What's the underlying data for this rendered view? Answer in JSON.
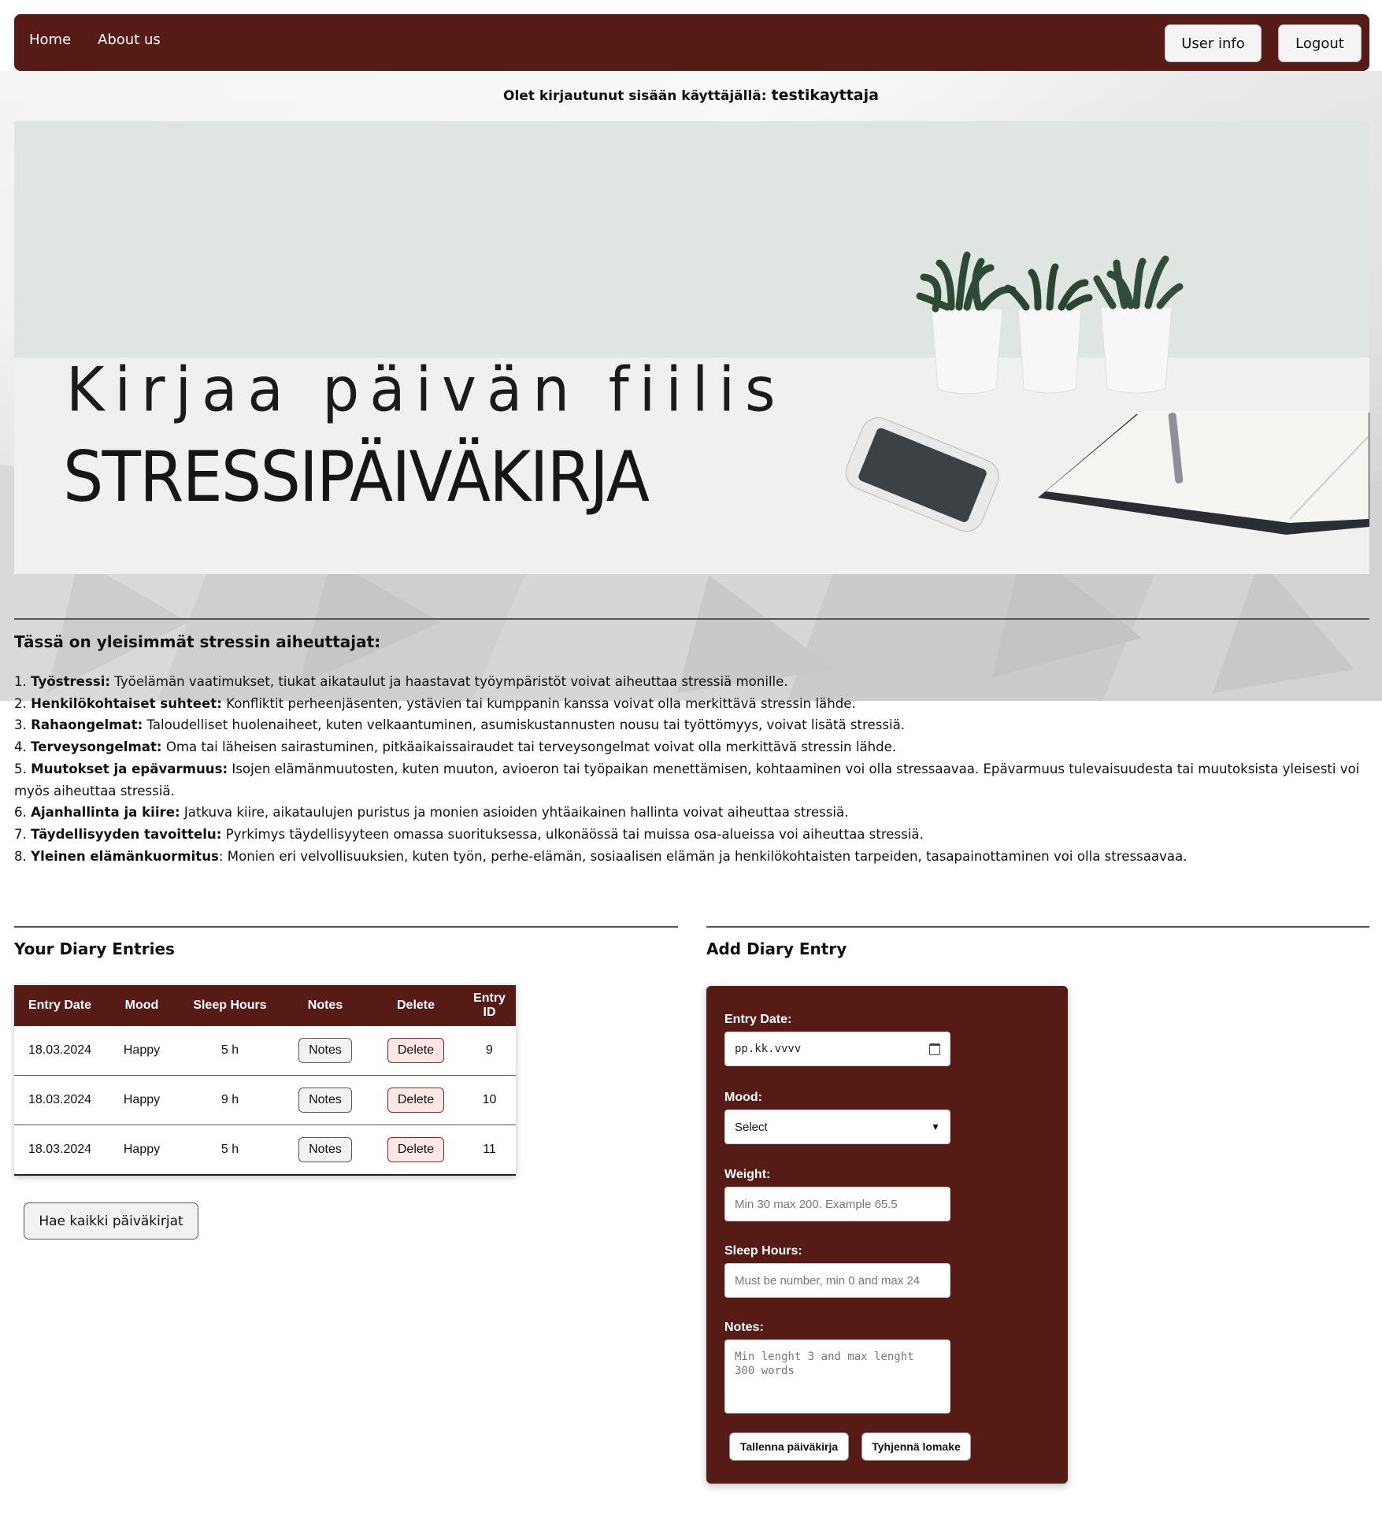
{
  "nav": {
    "home": "Home",
    "about": "About us",
    "user_info": "User info",
    "logout": "Logout"
  },
  "login": {
    "prefix": "Olet kirjautunut sisään käyttäjällä:",
    "username": "testikayttaja"
  },
  "hero": {
    "line1": "Kirjaa päivän fiilis",
    "line2": "STRESSIPÄIVÄKIRJA"
  },
  "causes": {
    "heading": "Tässä on yleisimmät stressin aiheuttajat:",
    "items": [
      {
        "num": "1.",
        "title": "Työstressi:",
        "text": " Työelämän vaatimukset, tiukat aikataulut ja haastavat työympäristöt voivat aiheuttaa stressiä monille."
      },
      {
        "num": "2.",
        "title": "Henkilökohtaiset suhteet:",
        "text": " Konfliktit perheenjäsenten, ystävien tai kumppanin kanssa voivat olla merkittävä stressin lähde."
      },
      {
        "num": "3.",
        "title": "Rahaongelmat:",
        "text": " Taloudelliset huolenaiheet, kuten velkaantuminen, asumiskustannusten nousu tai työttömyys, voivat lisätä stressiä."
      },
      {
        "num": "4.",
        "title": "Terveysongelmat:",
        "text": " Oma tai läheisen sairastuminen, pitkäaikaissairaudet tai terveysongelmat voivat olla merkittävä stressin lähde."
      },
      {
        "num": "5.",
        "title": "Muutokset ja epävarmuus:",
        "text": " Isojen elämänmuutosten, kuten muuton, avioeron tai työpaikan menettämisen, kohtaaminen voi olla stressaavaa. Epävarmuus tulevaisuudesta tai muutoksista yleisesti voi myös aiheuttaa stressiä."
      },
      {
        "num": "6.",
        "title": "Ajanhallinta ja kiire:",
        "text": " Jatkuva kiire, aikataulujen puristus ja monien asioiden yhtäaikainen hallinta voivat aiheuttaa stressiä."
      },
      {
        "num": "7.",
        "title": "Täydellisyyden tavoittelu:",
        "text": " Pyrkimys täydellisyyteen omassa suorituksessa, ulkonäössä tai muissa osa-alueissa voi aiheuttaa stressiä."
      },
      {
        "num": "8.",
        "title": "Yleinen elämänkuormitus",
        "text": ": Monien eri velvollisuuksien, kuten työn, perhe-elämän, sosiaalisen elämän ja henkilökohtaisten tarpeiden, tasapainottaminen voi olla stressaavaa."
      }
    ]
  },
  "entries": {
    "title": "Your Diary Entries",
    "columns": [
      "Entry Date",
      "Mood",
      "Sleep Hours",
      "Notes",
      "Delete",
      "Entry ID"
    ],
    "rows": [
      {
        "date": "18.03.2024",
        "mood": "Happy",
        "sleep": "5 h",
        "notes": "Notes",
        "delete": "Delete",
        "id": "9"
      },
      {
        "date": "18.03.2024",
        "mood": "Happy",
        "sleep": "9 h",
        "notes": "Notes",
        "delete": "Delete",
        "id": "10"
      },
      {
        "date": "18.03.2024",
        "mood": "Happy",
        "sleep": "5 h",
        "notes": "Notes",
        "delete": "Delete",
        "id": "11"
      }
    ],
    "fetch_all": "Hae kaikki päiväkirjat"
  },
  "form": {
    "title": "Add Diary Entry",
    "date_label": "Entry Date:",
    "date_placeholder": "pp.kk.vvvv",
    "mood_label": "Mood:",
    "mood_selected": "Select",
    "weight_label": "Weight:",
    "weight_placeholder": "Min 30 max 200. Example 65.5",
    "sleep_label": "Sleep Hours:",
    "sleep_placeholder": "Must be number, min 0 and max 24",
    "notes_label": "Notes:",
    "notes_placeholder": "Min lenght 3 and max lenght 300 words",
    "save": "Tallenna päiväkirja",
    "clear": "Tyhjennä lomake"
  },
  "colors": {
    "brand": "#561b14",
    "delete_bg": "#fde7e4"
  }
}
